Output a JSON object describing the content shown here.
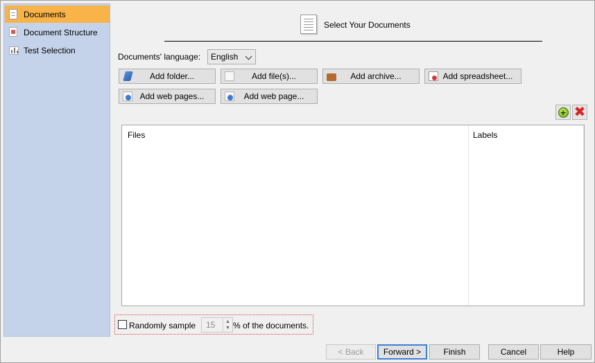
{
  "sidebar": {
    "items": [
      {
        "label": "Documents",
        "icon": "document-icon",
        "selected": true
      },
      {
        "label": "Document Structure",
        "icon": "structure-icon",
        "selected": false
      },
      {
        "label": "Test Selection",
        "icon": "bar-chart-icon",
        "selected": false
      }
    ]
  },
  "header": {
    "title": "Select Your Documents",
    "icon": "document-icon"
  },
  "language": {
    "label": "Documents' language:",
    "value": "English"
  },
  "buttons": {
    "add_folder": "Add folder...",
    "add_files": "Add file(s)...",
    "add_archive": "Add archive...",
    "add_spreadsheet": "Add spreadsheet...",
    "add_web_pages": "Add web pages...",
    "add_web_page": "Add web page..."
  },
  "table": {
    "columns": [
      "Files",
      "Labels"
    ],
    "rows": []
  },
  "sample": {
    "label": "Randomly sample",
    "checked": false,
    "value": "15",
    "suffix": "% of the documents."
  },
  "nav": {
    "back": "< Back",
    "forward": "Forward >",
    "finish": "Finish",
    "cancel": "Cancel",
    "help": "Help"
  },
  "colors": {
    "selected_item": "#f8b349",
    "sidebar_bg": "#c5d3ea",
    "window_bg": "#f0f0f0",
    "focus_border": "#3c7fd9"
  }
}
